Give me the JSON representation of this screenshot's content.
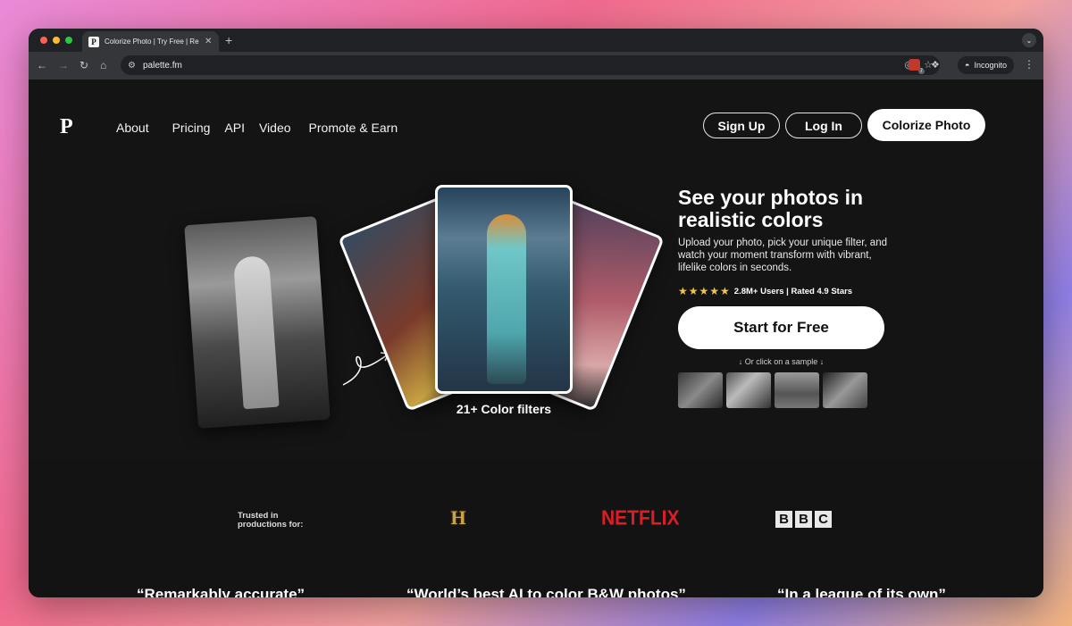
{
  "browser": {
    "tab_title": "Colorize Photo | Try Free | Re...",
    "tab_favicon": "P",
    "url": "palette.fm",
    "extension_badge": "7",
    "incognito_label": "Incognito"
  },
  "nav": {
    "logo": "P",
    "links": [
      "About",
      "Pricing",
      "API",
      "Video",
      "Promote & Earn"
    ],
    "sign_up": "Sign Up",
    "log_in": "Log In",
    "colorize": "Colorize Photo"
  },
  "hero": {
    "headline": "See your photos in realistic colors",
    "subtitle": "Upload your photo, pick your unique filter, and watch your moment transform with vibrant, lifelike colors in seconds.",
    "stars": "★★★★★",
    "rating_text": "2.8M+ Users | Rated 4.9 Stars",
    "cta": "Start for Free",
    "sample_hint": "↓ Or click on a sample ↓",
    "filters_label": "21+ Color filters"
  },
  "trusted": {
    "label": "Trusted in productions for:",
    "history_logo": "H",
    "netflix_logo": "NETFLIX",
    "bbc_logo": [
      "B",
      "B",
      "C"
    ]
  },
  "quotes": [
    "“Remarkably accurate”",
    "“World’s best AI to color B&W photos”",
    "“In a league of its own”"
  ],
  "colors": {
    "page_bg": "#131313",
    "netflix_red": "#d81f26",
    "star_gold": "#f6c443"
  }
}
